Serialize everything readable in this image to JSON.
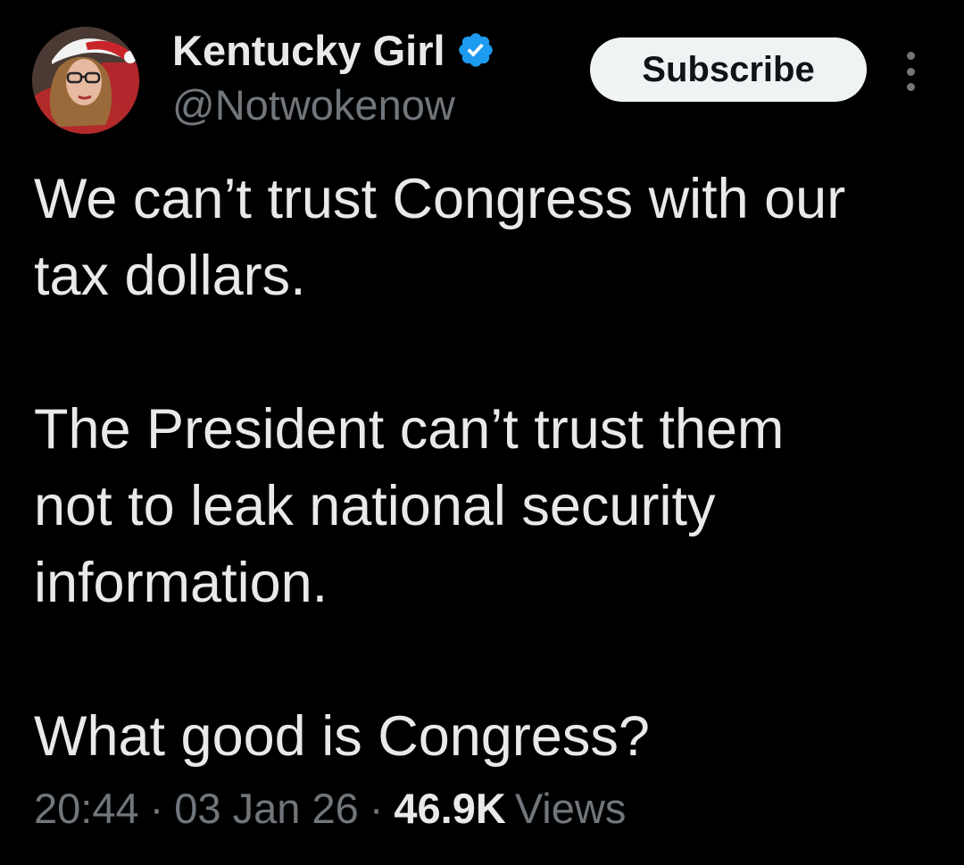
{
  "author": {
    "display_name": "Kentucky Girl",
    "handle": "@Notwokenow",
    "verified": true,
    "verified_color": "#1d9bf0"
  },
  "actions": {
    "subscribe_label": "Subscribe",
    "more_icon": "more-vertical-icon"
  },
  "tweet": {
    "paragraphs": [
      [
        "We can’t trust Congress with our",
        "tax dollars."
      ],
      [
        "The President can’t trust them",
        "not to leak national security",
        "information."
      ],
      [
        "What good is Congress?"
      ]
    ]
  },
  "meta": {
    "time": "20:44",
    "date": "03 Jan 26",
    "views_count": "46.9K",
    "views_label": "Views",
    "separator": "·"
  },
  "colors": {
    "background": "#000000",
    "text": "#e7e9ea",
    "muted": "#71767b",
    "button_bg": "#eff3f4",
    "button_text": "#0f1419"
  }
}
